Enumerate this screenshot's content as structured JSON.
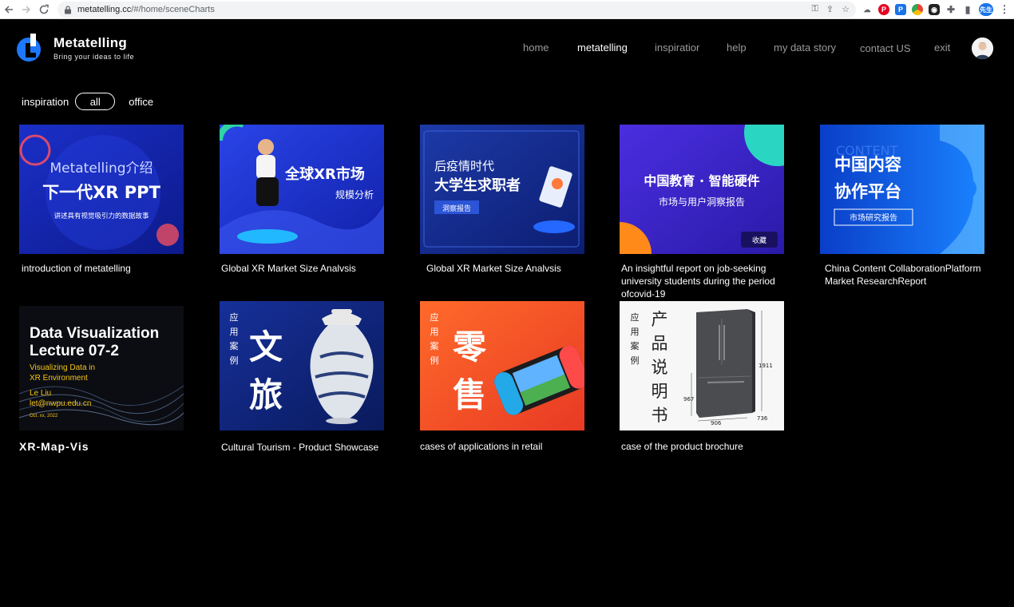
{
  "browser": {
    "url_host": "metatelling.cc",
    "url_path": "/#/home/sceneCharts",
    "profile_label": "先生"
  },
  "header": {
    "logo_title": "Metatelling",
    "logo_subtitle": "Bring your ideas to life",
    "nav": [
      {
        "label": "home",
        "active": false
      },
      {
        "label": "metatelling",
        "active": true
      },
      {
        "label": "inspiration",
        "active": false
      },
      {
        "label": "help",
        "active": false
      },
      {
        "label": "my data story",
        "active": false
      },
      {
        "label": "contact US",
        "active": false
      },
      {
        "label": "exit",
        "active": false
      }
    ]
  },
  "filter": {
    "label": "inspiration",
    "all": "all",
    "office": "office"
  },
  "cards": [
    {
      "caption": "introduction of metatelling",
      "lines": [
        "Metatelling介绍",
        "下一代XR PPT",
        "讲述具有视觉吸引力的数据故事"
      ]
    },
    {
      "caption": "Global XR Market Size Analvsis",
      "lines": [
        "全球XR市场",
        "规模分析"
      ]
    },
    {
      "caption": "Global XR Market Size Analvsis",
      "lines": [
        "后疫情时代",
        "大学生求职者",
        "洞察报告"
      ]
    },
    {
      "caption": "An insightful report on job-seeking\nuniversity students during the period\n ofcovid-19",
      "lines": [
        "中国教育 · 智能硬件",
        "市场与用户洞察报告",
        "收藏"
      ]
    },
    {
      "caption": "China Content CollaborationPlatform\nMarket ResearchReport",
      "lines": [
        "中国内容",
        "协作平台",
        "市场研究报告",
        "CONTENT"
      ]
    },
    {
      "caption": "XR-Map-Vis",
      "lines": [
        "Data Visualization",
        "Lecture 07-2",
        "Visualizing Data in",
        "XR Environment",
        "Le Liu",
        "let@nwpu.edu.cn",
        "Oct. xx, 2022"
      ]
    },
    {
      "caption": "Cultural Tourism - Product Showcase",
      "lines": [
        "应",
        "用",
        "案",
        "例",
        "文",
        "旅"
      ]
    },
    {
      "caption": "cases of applications in retail",
      "lines": [
        "应",
        "用",
        "案",
        "例",
        "零",
        "售"
      ]
    },
    {
      "caption": "case of the product brochure",
      "lines": [
        "应",
        "用",
        "案",
        "例",
        "产",
        "品",
        "说",
        "明",
        "书",
        "1911",
        "967",
        "906",
        "736"
      ]
    }
  ]
}
